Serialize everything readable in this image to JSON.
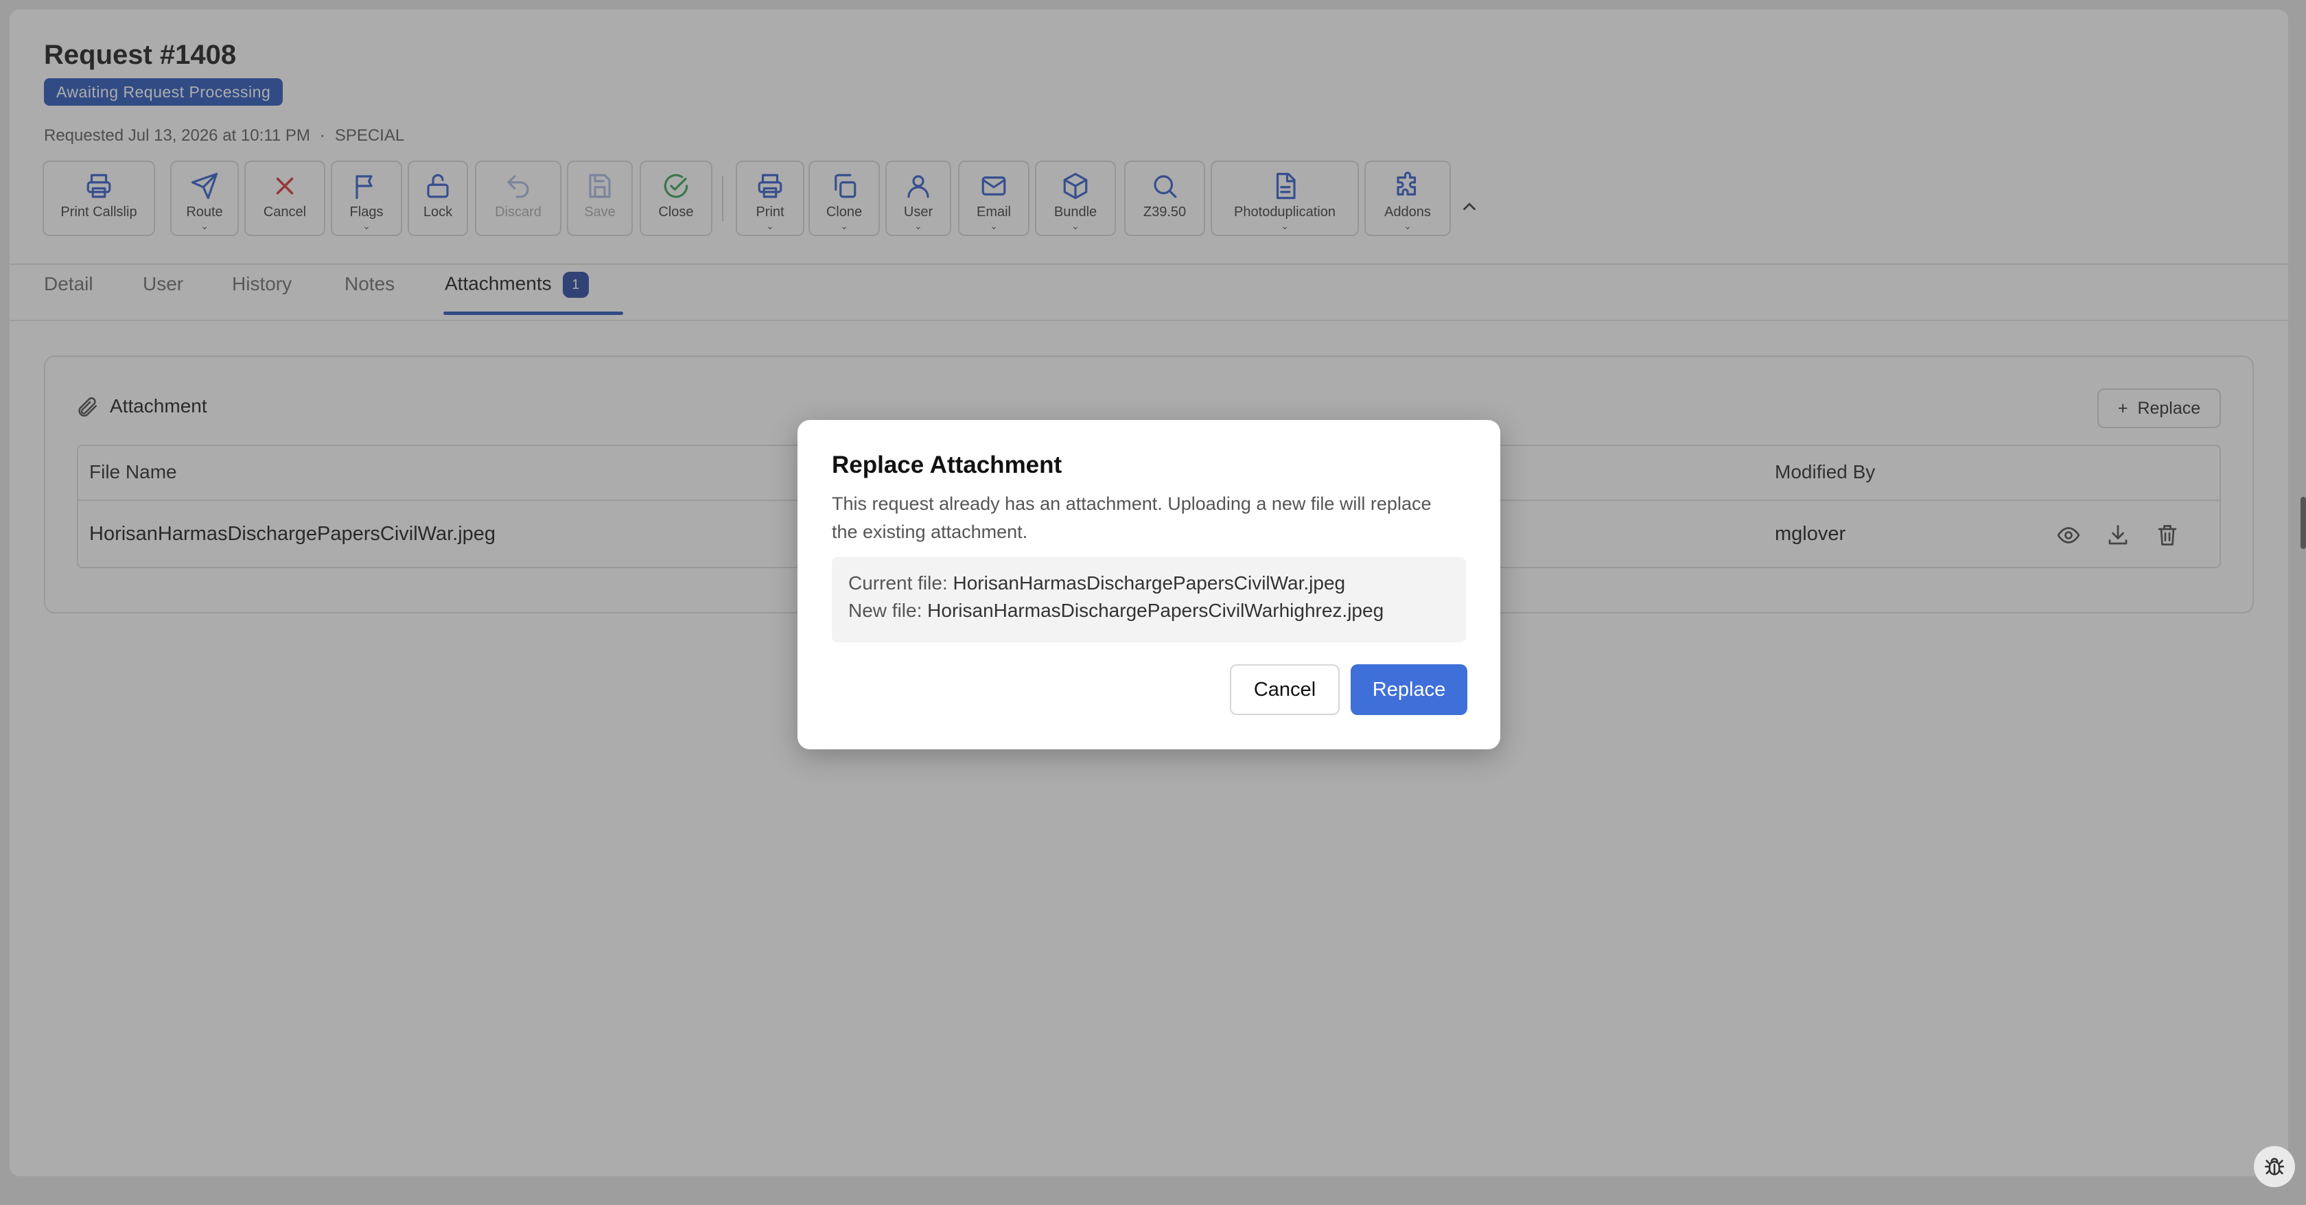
{
  "request": {
    "title": "Request #1408",
    "status": "Awaiting Request Processing",
    "requested": "Requested Jul 13, 2026 at 10:11 PM",
    "separator": "·",
    "type": "SPECIAL"
  },
  "toolbar": {
    "print_callslip": "Print Callslip",
    "route": "Route",
    "cancel": "Cancel",
    "flags": "Flags",
    "lock": "Lock",
    "discard": "Discard",
    "save": "Save",
    "close": "Close",
    "print": "Print",
    "clone": "Clone",
    "user": "User",
    "email": "Email",
    "bundle": "Bundle",
    "z3950": "Z39.50",
    "photoduplication": "Photoduplication",
    "addons": "Addons",
    "caret": "⌄"
  },
  "tabs": {
    "detail": "Detail",
    "user": "User",
    "history": "History",
    "notes": "Notes",
    "attachments": "Attachments",
    "attachments_count": "1"
  },
  "attachment_card": {
    "title": "Attachment",
    "replace_label": "Replace",
    "plus": "+",
    "columns": {
      "file_name": "File Name",
      "modified_by": "Modified By"
    },
    "rows": [
      {
        "file_name": "HorisanHarmasDischargePapersCivilWar.jpeg",
        "modified_by": "mglover"
      }
    ]
  },
  "modal": {
    "title": "Replace Attachment",
    "description": "This request already has an attachment. Uploading a new file will replace the existing attachment.",
    "current_label": "Current file:",
    "current_file": "HorisanHarmasDischargePapersCivilWar.jpeg",
    "new_label": "New file:",
    "new_file": "HorisanHarmasDischargePapersCivilWarhighrez.jpeg",
    "cancel_label": "Cancel",
    "replace_label": "Replace"
  },
  "colors": {
    "primary": "#1f4fb8",
    "modal_primary": "#3f6fd8",
    "cancel_red": "#d32f2f",
    "close_green": "#2e9e4f",
    "icon_blue": "#2b56c8"
  }
}
